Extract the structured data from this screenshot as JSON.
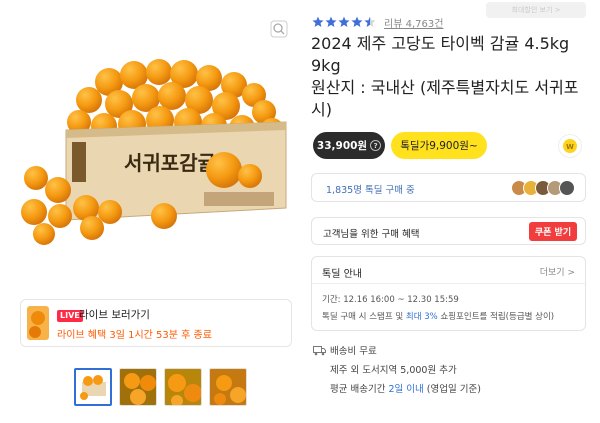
{
  "product": {
    "title": "2024 제주 고당도 타이벡 감귤 4.5kg 9kg",
    "origin": "원산지 : 국내산 (제주특별자치도 서귀포시)",
    "rating": {
      "score": 4.5,
      "review_label": "리뷰 4,763건"
    },
    "notice_chip": "최대할인 보기 >"
  },
  "pricing": {
    "normal_price": "33,900원",
    "special_price": "톡딜가9,900원~"
  },
  "social_proof": {
    "buyers_text": "1,835명 톡딜 구매 중"
  },
  "benefit": {
    "text": "고객님을 위한 구매 혜택",
    "coupon_button": "쿠폰 받기"
  },
  "deal": {
    "title": "톡딜 안내",
    "more": "더보기 >",
    "period_label": "기간",
    "period_value": ": 12.16 16:00 ~ 12.30 15:59",
    "desc_prefix": "톡딜 구매 시 스탬프 및 ",
    "desc_highlight": "최대 3%",
    "desc_suffix": " 쇼핑포인트를 적립(등급별 상이)"
  },
  "shipping": {
    "fee": "배송비 무료",
    "extra_prefix": "제주 외 도서지역 ",
    "extra_value": "5,000원 추가",
    "avg_prefix": "평균 배송기간 ",
    "avg_highlight": "2일 이내",
    "avg_suffix": " (영업일 기준)"
  },
  "live": {
    "badge": "LIVE",
    "title": "라이브 보러가기",
    "countdown": "라이브 혜택 3일 1시간 53분 후 종료"
  },
  "product_image": {
    "box_label": "서귀포감귤"
  },
  "thumbnails": [
    "thumb-1",
    "thumb-2",
    "thumb-3",
    "thumb-4"
  ],
  "colors": {
    "special_price_bg": "#ffe11e",
    "coupon_bg": "#f13d3d",
    "live_red": "#ff2a43",
    "link_blue": "#2f6fd6",
    "star": "#3f6fd8"
  }
}
